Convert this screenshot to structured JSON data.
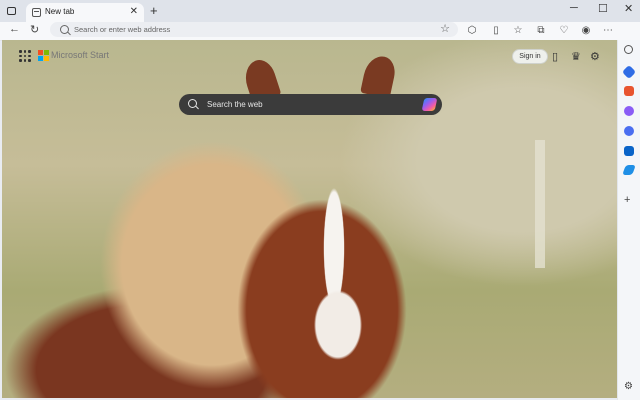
{
  "tab": {
    "title": "New tab",
    "close": "✕"
  },
  "newtab": "+",
  "window": {
    "minimize": "─",
    "maximize": "☐",
    "close": "✕"
  },
  "address": {
    "placeholder": "Search or enter web address"
  },
  "brand": {
    "name": "Microsoft Start"
  },
  "header": {
    "signin": "Sign in"
  },
  "search": {
    "placeholder": "Search the web"
  },
  "colors": {
    "ms_red": "#f25022",
    "ms_green": "#7fba00",
    "ms_blue": "#00a4ef",
    "ms_yellow": "#ffb900"
  },
  "sidebar": {
    "items": [
      {
        "name": "search",
        "color": "#555"
      },
      {
        "name": "shopping-tag",
        "color": "#2f6ce5"
      },
      {
        "name": "tools",
        "color": "#e8542f"
      },
      {
        "name": "people",
        "color": "#8a5cf5"
      },
      {
        "name": "games",
        "color": "#4b6ef0"
      },
      {
        "name": "outlook",
        "color": "#0a64c8"
      },
      {
        "name": "send",
        "color": "#1f8fe6"
      }
    ]
  }
}
